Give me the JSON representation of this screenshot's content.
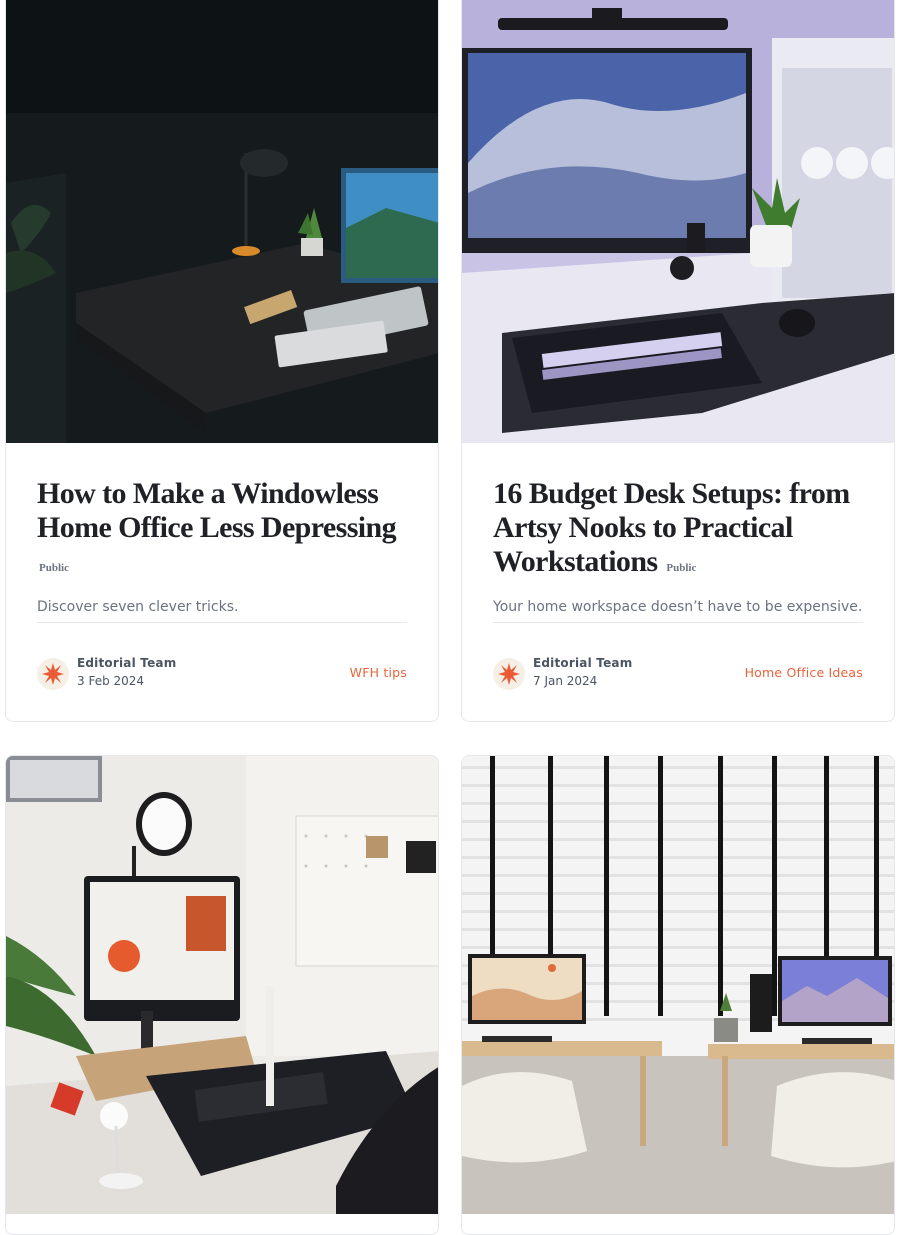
{
  "cards": [
    {
      "title": "How to Make a Windowless Home Office Less Depressing",
      "visibility": "Public",
      "description": "Discover seven clever tricks.",
      "author": "Editorial Team",
      "date": "3 Feb 2024",
      "tag": "WFH tips",
      "image_icon": "dark-desk-photo"
    },
    {
      "title": "16 Budget Desk Setups: from Artsy Nooks to Practical Workstations",
      "visibility": "Public",
      "description": "Your home workspace doesn’t have to be expensive.",
      "author": "Editorial Team",
      "date": "7 Jan 2024",
      "tag": "Home Office Ideas",
      "image_icon": "gaming-desk-photo"
    },
    {
      "image_icon": "white-desk-photo"
    },
    {
      "image_icon": "twin-desks-photo"
    }
  ],
  "colors": {
    "accent": "#e8643b",
    "text": "#1f2126",
    "muted": "#6b7280",
    "border": "#e5e7eb"
  }
}
